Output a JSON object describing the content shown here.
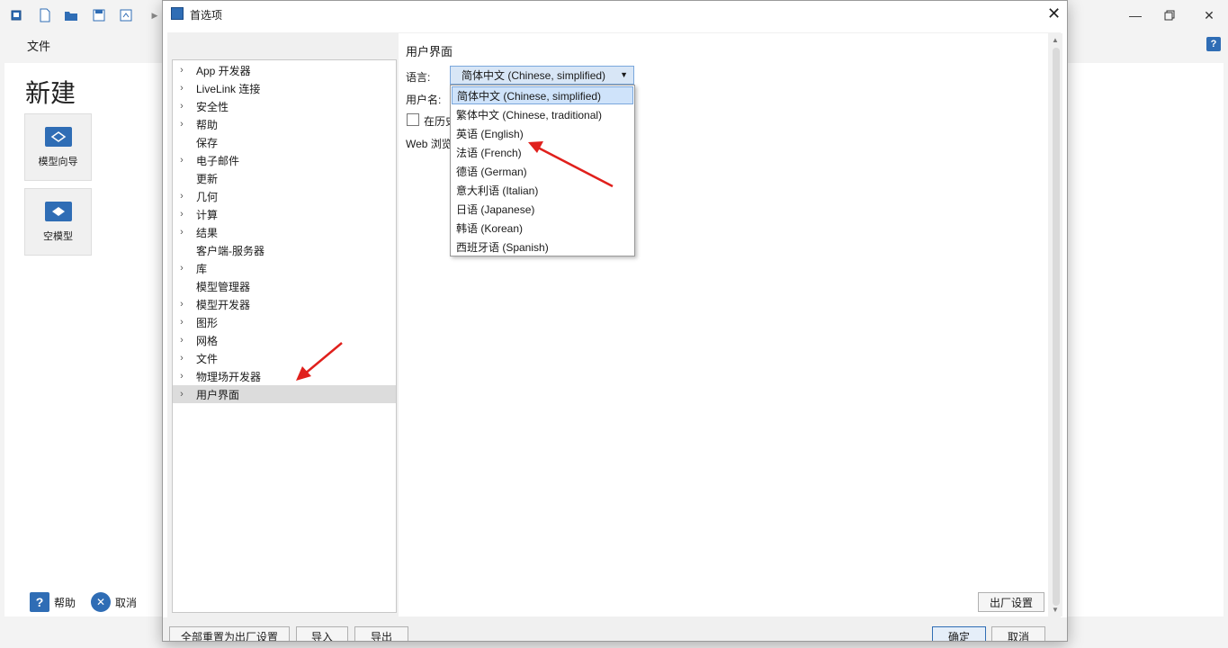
{
  "app": {
    "menu_file": "文件",
    "help_q": "?",
    "new_title": "新建",
    "tiles": [
      {
        "label": "模型向导",
        "icon": "model-wizard-icon"
      },
      {
        "label": "空模型",
        "icon": "blank-model-icon"
      }
    ],
    "bottom": {
      "help": "帮助",
      "cancel": "取消"
    },
    "accent": "#2f6db5"
  },
  "dialog": {
    "title": "首选项",
    "tree": [
      {
        "label": "App 开发器",
        "expandable": true
      },
      {
        "label": "LiveLink 连接",
        "expandable": true
      },
      {
        "label": "安全性",
        "expandable": true
      },
      {
        "label": "帮助",
        "expandable": true
      },
      {
        "label": "保存",
        "expandable": false
      },
      {
        "label": "电子邮件",
        "expandable": true
      },
      {
        "label": "更新",
        "expandable": false
      },
      {
        "label": "几何",
        "expandable": true
      },
      {
        "label": "计算",
        "expandable": true
      },
      {
        "label": "结果",
        "expandable": true
      },
      {
        "label": "客户端-服务器",
        "expandable": false
      },
      {
        "label": "库",
        "expandable": true
      },
      {
        "label": "模型管理器",
        "expandable": false
      },
      {
        "label": "模型开发器",
        "expandable": true
      },
      {
        "label": "图形",
        "expandable": true
      },
      {
        "label": "网格",
        "expandable": true
      },
      {
        "label": "文件",
        "expandable": true
      },
      {
        "label": "物理场开发器",
        "expandable": true
      },
      {
        "label": "用户界面",
        "expandable": true,
        "selected": true
      }
    ],
    "section_title": "用户界面",
    "language_label": "语言:",
    "language_value": "简体中文 (Chinese, simplified)",
    "username_label": "用户名:",
    "history_label": "在历史",
    "web_label": "Web 浏览",
    "language_options": [
      "简体中文 (Chinese, simplified)",
      "繁体中文 (Chinese, traditional)",
      "英语 (English)",
      "法语 (French)",
      "德语 (German)",
      "意大利语 (Italian)",
      "日语 (Japanese)",
      "韩语 (Korean)",
      "西班牙语 (Spanish)"
    ],
    "factory_button": "出厂设置",
    "bottom_buttons": [
      "全部重置为出厂设置",
      "导入",
      "导出",
      "确定",
      "取消"
    ]
  }
}
